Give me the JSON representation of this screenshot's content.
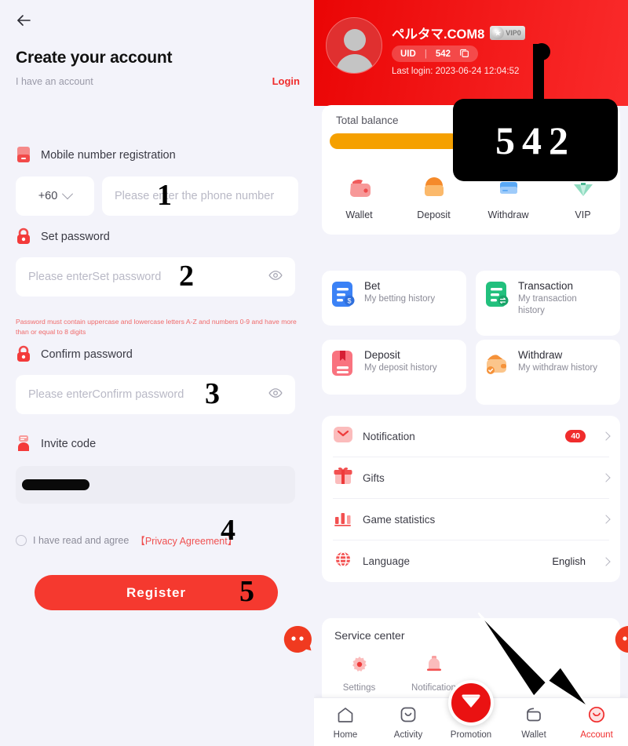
{
  "register": {
    "back_icon": "back-arrow-icon",
    "title": "Create your account",
    "have_account": "I have an account",
    "login_link": "Login",
    "mobile_section_label": "Mobile number registration",
    "country_code": "+60",
    "phone_placeholder": "Please enter the phone number",
    "set_password_label": "Set password",
    "set_password_placeholder": "Please enterSet password",
    "password_hint": "Password must contain uppercase and lowercase letters A-Z and numbers 0-9 and have more than or equal to 8 digits",
    "confirm_password_label": "Confirm password",
    "confirm_password_placeholder": "Please enterConfirm password",
    "invite_code_label": "Invite code",
    "invite_code_value": "",
    "agree_text": "I have read and agree",
    "privacy_link": "【Privacy Agreement】",
    "register_button": "Register"
  },
  "annotations": {
    "steps": [
      "1",
      "2",
      "3",
      "4",
      "5"
    ],
    "callout_value": "542"
  },
  "account": {
    "username": "ペルタマ.COM8",
    "vip_level": "VIP0",
    "uid_label": "UID",
    "uid_separator": "|",
    "uid_value": "542",
    "copy_icon": "copy-icon",
    "last_login": "Last login: 2023-06-24 12:04:52",
    "balance": {
      "label": "Total balance",
      "value": ""
    },
    "wallet_actions": [
      {
        "label": "Wallet",
        "icon": "wallet-icon"
      },
      {
        "label": "Deposit",
        "icon": "deposit-icon"
      },
      {
        "label": "Withdraw",
        "icon": "withdraw-icon"
      },
      {
        "label": "VIP",
        "icon": "vip-diamond-icon"
      }
    ],
    "history_cards": [
      {
        "title": "Bet",
        "subtitle": "My betting history",
        "icon": "bet-document-icon",
        "color": "#3b82f6"
      },
      {
        "title": "Transaction",
        "subtitle": "My transaction history",
        "icon": "transaction-document-icon",
        "color": "#22c07d"
      },
      {
        "title": "Deposit",
        "subtitle": "My deposit history",
        "icon": "deposit-document-icon",
        "color": "#f2576b"
      },
      {
        "title": "Withdraw",
        "subtitle": "My withdraw history",
        "icon": "withdraw-wallet-icon",
        "color": "#f5a04a"
      }
    ],
    "menu": [
      {
        "label": "Notification",
        "icon": "envelope-icon",
        "badge": "40",
        "value": ""
      },
      {
        "label": "Gifts",
        "icon": "gift-icon",
        "badge": "",
        "value": ""
      },
      {
        "label": "Game statistics",
        "icon": "bar-chart-icon",
        "badge": "",
        "value": ""
      },
      {
        "label": "Language",
        "icon": "globe-icon",
        "badge": "",
        "value": "English"
      }
    ],
    "service_center": {
      "title": "Service center",
      "items": [
        {
          "label": "Settings",
          "icon": "gear-icon"
        },
        {
          "label": "Notification",
          "icon": "bell-icon"
        }
      ]
    },
    "bottom_nav": [
      {
        "label": "Home",
        "icon": "home-icon",
        "active": false
      },
      {
        "label": "Activity",
        "icon": "activity-icon",
        "active": false
      },
      {
        "label": "Promotion",
        "icon": "diamond-icon",
        "active": false
      },
      {
        "label": "Wallet",
        "icon": "wallet-nav-icon",
        "active": false
      },
      {
        "label": "Account",
        "icon": "account-icon",
        "active": true
      }
    ]
  },
  "colors": {
    "brand_red": "#f02c2c",
    "header_red": "#ea0505",
    "balance_orange": "#f5a000",
    "page_bg": "#f3f3fa"
  }
}
